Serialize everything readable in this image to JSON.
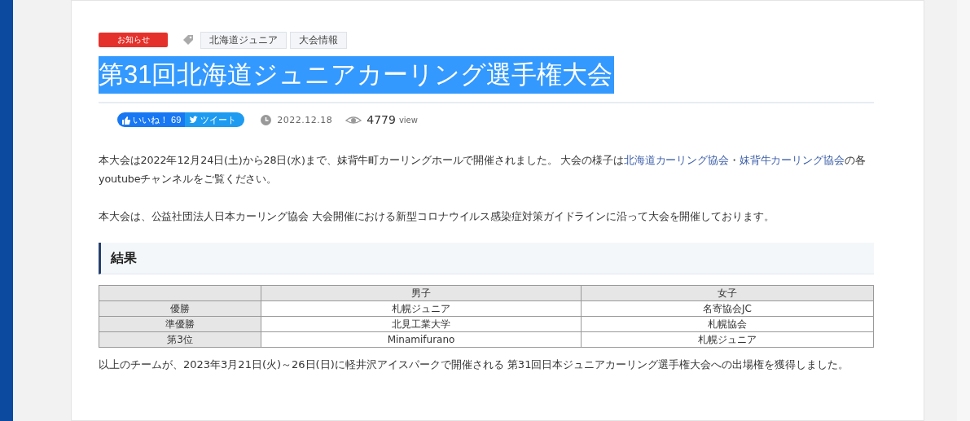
{
  "category": "お知らせ",
  "tags": [
    "北海道ジュニア",
    "大会情報"
  ],
  "title": "第31回北海道ジュニアカーリング選手権大会",
  "like_button": {
    "label": "いいね！",
    "count": "69"
  },
  "tweet_button": {
    "label": "ツイート"
  },
  "date": "2022.12.18",
  "views": {
    "count": "4779",
    "unit": "view"
  },
  "paragraphs": [
    [
      {
        "kind": "text",
        "text": "本大会は2022年12月24日(土)から28日(水)まで、妹背牛町カーリングホールで開催されました。 大会の様子は"
      },
      {
        "kind": "link",
        "text": "北海道カーリング協会"
      },
      {
        "kind": "text",
        "text": "・"
      },
      {
        "kind": "link",
        "text": "妹背牛カーリング協会"
      },
      {
        "kind": "text",
        "text": "の各youtubeチャンネルをご覧ください。"
      }
    ],
    [
      {
        "kind": "text",
        "text": "本大会は、公益社団法人日本カーリング協会 大会開催における新型コロナウイルス感染症対策ガイドラインに沿って大会を開催しております。"
      }
    ]
  ],
  "section_heading": "結果",
  "table": {
    "columns": [
      "男子",
      "女子"
    ],
    "rows": [
      {
        "label": "優勝",
        "cells": [
          "札幌ジュニア",
          "名寄協会JC"
        ]
      },
      {
        "label": "準優勝",
        "cells": [
          "北見工業大学",
          "札幌協会"
        ]
      },
      {
        "label": "第3位",
        "cells": [
          "Minamifurano",
          "札幌ジュニア"
        ]
      }
    ]
  },
  "footer_text": "以上のチームが、2023年3月21日(火)～26日(日)に軽井沢アイスパークで開催される 第31回日本ジュニアカーリング選手権大会への出場権を獲得しました。"
}
